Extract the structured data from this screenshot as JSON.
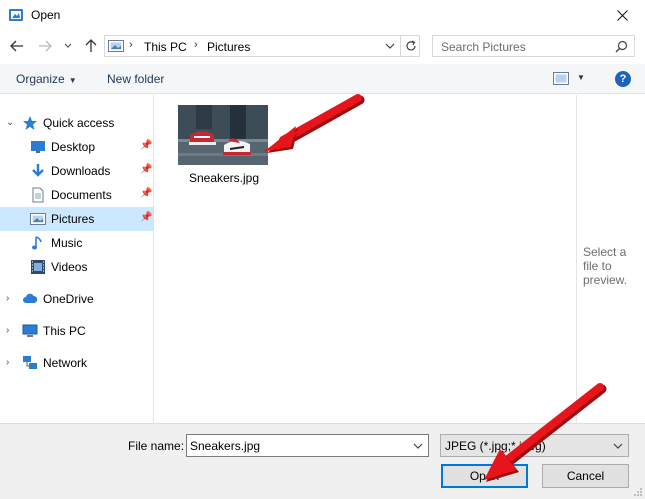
{
  "window": {
    "title": "Open"
  },
  "address": {
    "crumbs": [
      "This PC",
      "Pictures"
    ]
  },
  "search": {
    "placeholder": "Search Pictures"
  },
  "toolbar": {
    "organize": "Organize",
    "new_folder": "New folder",
    "help": "?"
  },
  "sidebar": {
    "quick_access": "Quick access",
    "items": [
      {
        "label": "Desktop",
        "icon": "desktop-icon",
        "pinned": true
      },
      {
        "label": "Downloads",
        "icon": "downloads-icon",
        "pinned": true
      },
      {
        "label": "Documents",
        "icon": "documents-icon",
        "pinned": true
      },
      {
        "label": "Pictures",
        "icon": "pictures-icon",
        "pinned": true,
        "selected": true
      },
      {
        "label": "Music",
        "icon": "music-icon",
        "pinned": false
      },
      {
        "label": "Videos",
        "icon": "videos-icon",
        "pinned": false
      }
    ],
    "onedrive": "OneDrive",
    "this_pc": "This PC",
    "network": "Network"
  },
  "files": [
    {
      "name": "Sneakers.jpg"
    }
  ],
  "preview": {
    "text": "Select a file to preview."
  },
  "bottom": {
    "file_name_label": "File name:",
    "file_name_value": "Sneakers.jpg",
    "file_type": "JPEG (*.jpg;*.jpeg)",
    "open_label": "Open",
    "cancel_label": "Cancel"
  },
  "colors": {
    "selection": "#cce8ff",
    "accent": "#0078d7",
    "annotation_arrow": "#e8141b"
  }
}
